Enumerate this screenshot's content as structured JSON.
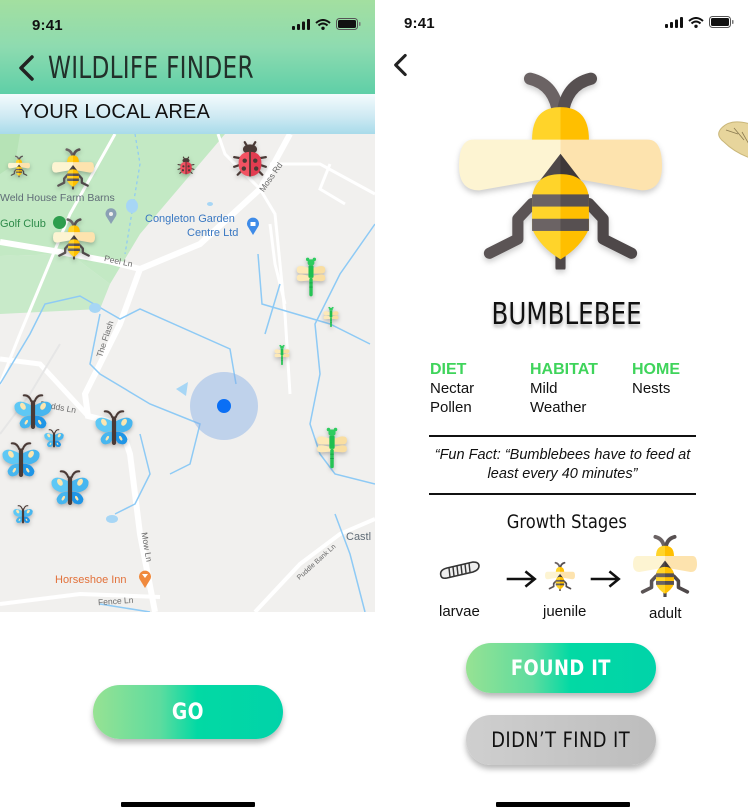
{
  "left_screen": {
    "status": {
      "time": "9:41"
    },
    "header": {
      "title": "WILDLIFE FINDER",
      "back_icon": "chevron-left-icon"
    },
    "subheader": {
      "title": "YOUR LOCAL AREA"
    },
    "map": {
      "labels": {
        "weld_house": "Weld House Farm Barns",
        "golf_club": "Golf Club",
        "congleton_1": "Congleton Garden",
        "congleton_2": "Centre Ltd",
        "peel_ln": "Peel Ln",
        "moss_rd": "Moss Rd",
        "the_flash": "The Flash",
        "dodds_ln": "Dodds Ln",
        "mow_ln": "Mow Ln",
        "horseshoe_inn": "Horseshoe Inn",
        "fence_ln": "Fence Ln",
        "puddle_bank_ln": "Puddle Bank Ln",
        "castle": "Castl"
      },
      "markers": [
        {
          "type": "bee"
        },
        {
          "type": "bee"
        },
        {
          "type": "bee"
        },
        {
          "type": "ladybug"
        },
        {
          "type": "ladybug"
        },
        {
          "type": "dragonfly"
        },
        {
          "type": "dragonfly"
        },
        {
          "type": "dragonfly"
        },
        {
          "type": "dragonfly"
        },
        {
          "type": "butterfly"
        },
        {
          "type": "butterfly"
        },
        {
          "type": "butterfly"
        },
        {
          "type": "butterfly"
        },
        {
          "type": "butterfly"
        },
        {
          "type": "butterfly"
        },
        {
          "type": "butterfly"
        }
      ]
    },
    "go_button": "GO"
  },
  "right_screen": {
    "status": {
      "time": "9:41"
    },
    "back_icon": "chevron-left-icon",
    "species": "BUMBLEBEE",
    "info": [
      {
        "heading": "DIET",
        "lines": [
          "Nectar",
          "Pollen"
        ]
      },
      {
        "heading": "HABITAT",
        "lines": [
          "Mild",
          "Weather"
        ]
      },
      {
        "heading": "HOME",
        "lines": [
          "Nests"
        ]
      }
    ],
    "fun_fact": "“Fun Fact: “Bumblebees have to feed at least every 40 minutes”",
    "growth": {
      "title": "Growth Stages",
      "stages": [
        {
          "label": "larvae",
          "icon": "larva-icon"
        },
        {
          "label": "juenile",
          "icon": "small-bee-icon"
        },
        {
          "label": "adult",
          "icon": "bee-icon"
        }
      ]
    },
    "found_button": "FOUND IT",
    "not_found_button": "DIDN’T FIND IT"
  },
  "colors": {
    "accent_green": "#3fd45b",
    "button_gradient_start": "#97e293",
    "button_gradient_end": "#01d3a9",
    "user_location": "#0a6ff5"
  }
}
